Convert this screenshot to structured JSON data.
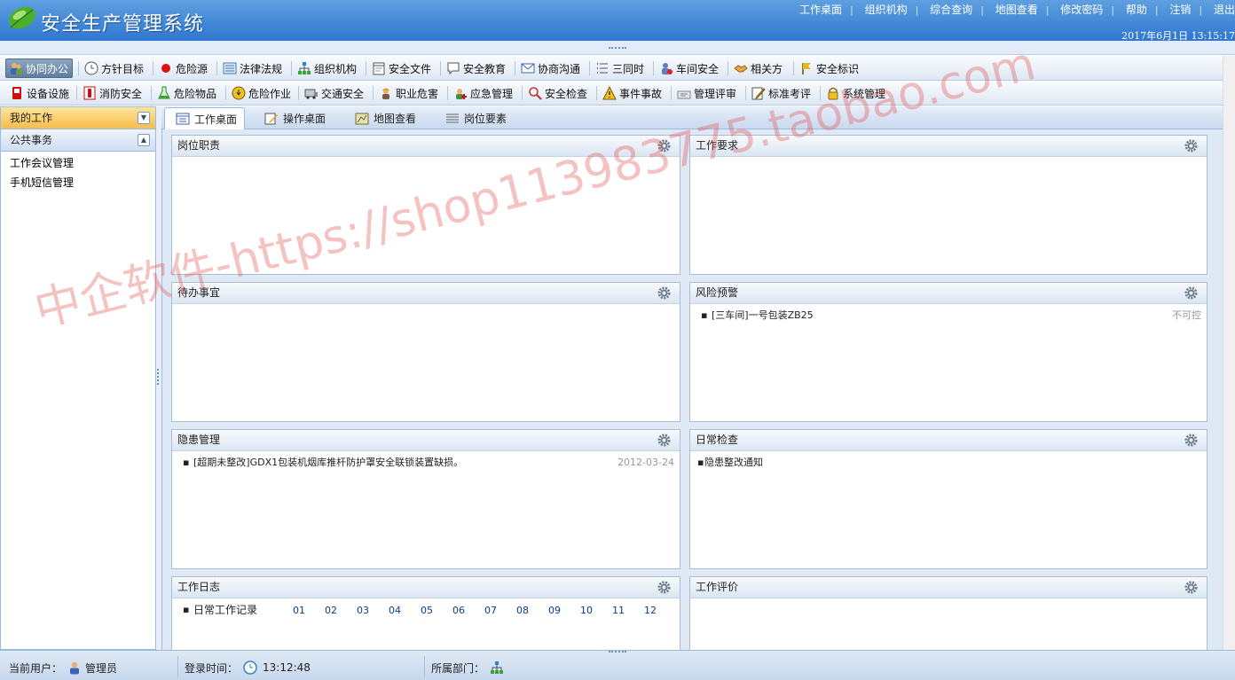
{
  "header": {
    "title": "安全生产管理系统",
    "links": [
      "工作桌面",
      "组织机构",
      "综合查询",
      "地图查看",
      "修改密码",
      "帮助",
      "注销",
      "退出"
    ],
    "date": "2017年6月1日",
    "time": "13:15:17"
  },
  "toolbar1": [
    {
      "label": "协同办公",
      "icon": "people-icon",
      "selected": true
    },
    {
      "label": "方针目标",
      "icon": "clock-icon"
    },
    {
      "label": "危险源",
      "icon": "red-dot-icon"
    },
    {
      "label": "法律法规",
      "icon": "list-icon"
    },
    {
      "label": "组织机构",
      "icon": "org-chart-icon"
    },
    {
      "label": "安全文件",
      "icon": "calendar-icon"
    },
    {
      "label": "安全教育",
      "icon": "speech-bubble-icon"
    },
    {
      "label": "协商沟通",
      "icon": "envelope-icon"
    },
    {
      "label": "三同时",
      "icon": "numbered-list-icon"
    },
    {
      "label": "车间安全",
      "icon": "user-lock-icon"
    },
    {
      "label": "相关方",
      "icon": "handshake-icon"
    },
    {
      "label": "安全标识",
      "icon": "flag-icon"
    }
  ],
  "toolbar2": [
    {
      "label": "设备设施",
      "icon": "device-icon"
    },
    {
      "label": "消防安全",
      "icon": "extinguisher-icon"
    },
    {
      "label": "危险物品",
      "icon": "flask-icon"
    },
    {
      "label": "危险作业",
      "icon": "hazard-icon"
    },
    {
      "label": "交通安全",
      "icon": "vehicle-icon"
    },
    {
      "label": "职业危害",
      "icon": "worker-icon"
    },
    {
      "label": "应急管理",
      "icon": "emergency-icon"
    },
    {
      "label": "安全检查",
      "icon": "magnifier-icon"
    },
    {
      "label": "事件事故",
      "icon": "warning-icon"
    },
    {
      "label": "管理评审",
      "icon": "review-icon"
    },
    {
      "label": "标准考评",
      "icon": "edit-icon"
    },
    {
      "label": "系统管理",
      "icon": "lock-icon"
    }
  ],
  "sidebar": {
    "my_work": "我的工作",
    "public_affairs": "公共事务",
    "items": [
      "工作会议管理",
      "手机短信管理"
    ]
  },
  "tabs": [
    {
      "label": "工作桌面",
      "icon": "desktop-icon",
      "active": true
    },
    {
      "label": "操作桌面",
      "icon": "pencil-icon"
    },
    {
      "label": "地图查看",
      "icon": "map-icon"
    },
    {
      "label": "岗位要素",
      "icon": "grid-icon"
    }
  ],
  "portlets": {
    "duty": {
      "title": "岗位职责"
    },
    "requirement": {
      "title": "工作要求"
    },
    "todo": {
      "title": "待办事宜"
    },
    "risk": {
      "title": "风险预警",
      "items": [
        {
          "text": "[三车间]一号包装ZB25",
          "status": "不可控"
        }
      ]
    },
    "hazard": {
      "title": "隐患管理",
      "items": [
        {
          "text": "[超期未整改]GDX1包装机烟库推杆防护罩安全联锁装置缺损。",
          "date": "2012-03-24"
        }
      ]
    },
    "daily": {
      "title": "日常检查",
      "items": [
        "隐患整改通知"
      ]
    },
    "log": {
      "title": "工作日志",
      "label": "日常工作记录",
      "months": [
        "01",
        "02",
        "03",
        "04",
        "05",
        "06",
        "07",
        "08",
        "09",
        "10",
        "11",
        "12"
      ]
    },
    "eval": {
      "title": "工作评价"
    }
  },
  "statusbar": {
    "user_label": "当前用户：",
    "user": "管理员",
    "login_label": "登录时间：",
    "login_time": "13:12:48",
    "dept_label": "所属部门："
  },
  "watermark": "中企软件-https://shop113983775.taobao.com",
  "colors": {
    "header": "#2f78d0",
    "accent": "#f6bd4b",
    "border": "#99bbe8"
  }
}
